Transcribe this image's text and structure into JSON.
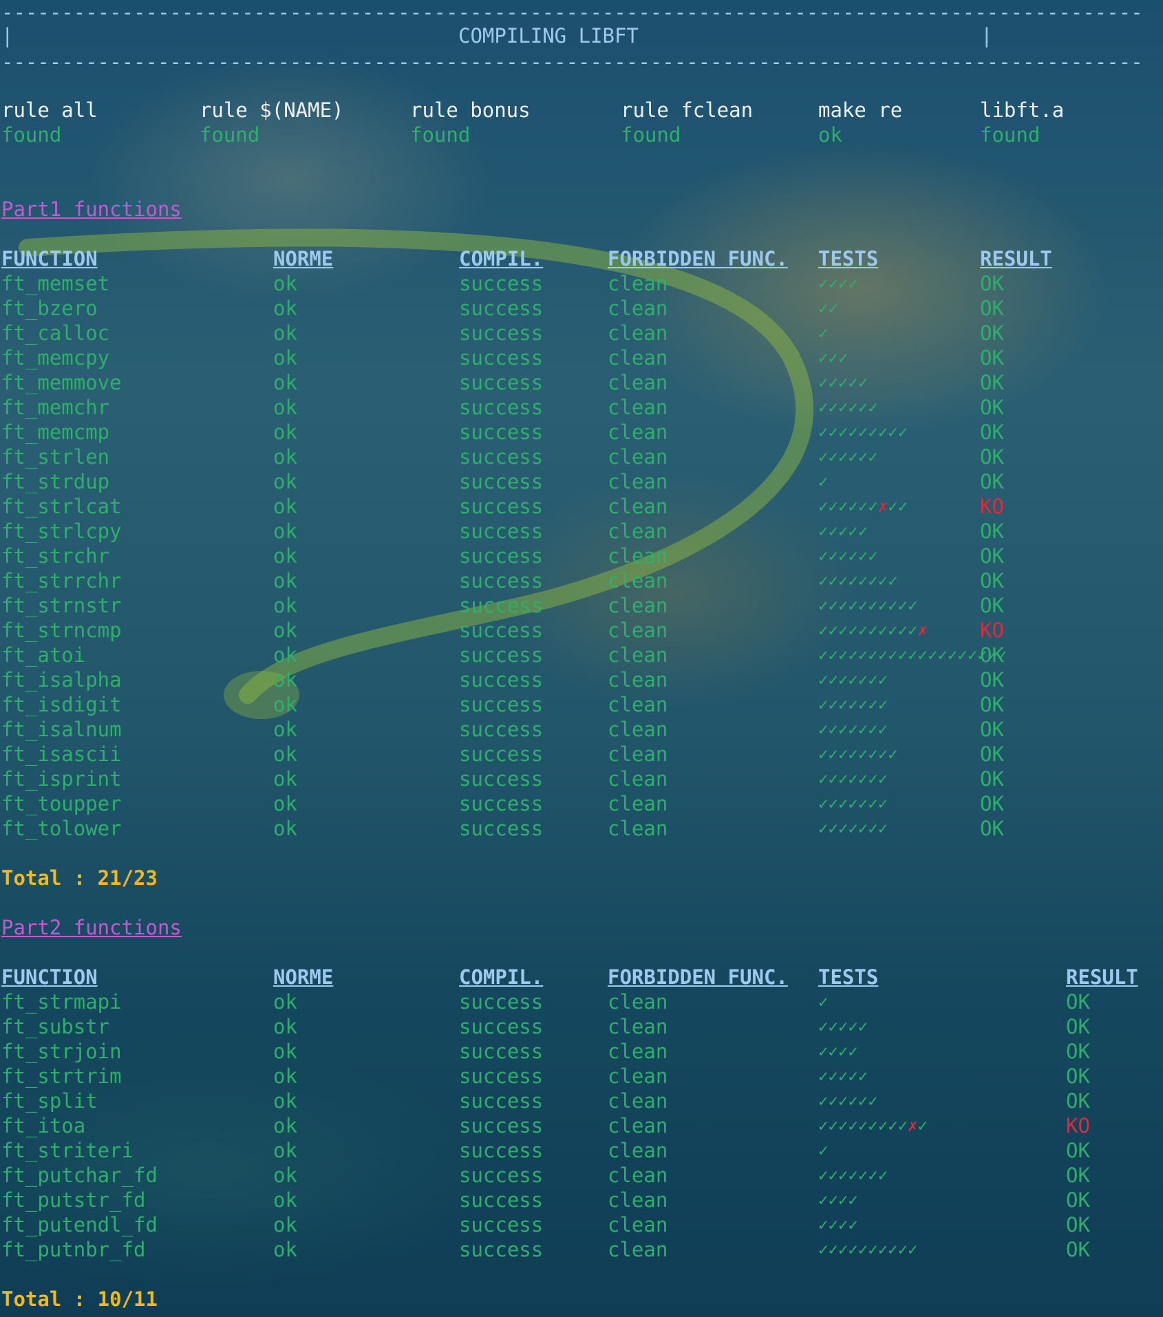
{
  "banner": {
    "dashes": "-----------------------------------------------------------------------------------------------",
    "left_bar": "|",
    "title": "COMPILING LIBFT",
    "right_bar": "|"
  },
  "rules": [
    {
      "label": "rule all",
      "status": "found"
    },
    {
      "label": "rule $(NAME)",
      "status": "found"
    },
    {
      "label": "rule bonus",
      "status": "found"
    },
    {
      "label": "rule fclean",
      "status": "found"
    },
    {
      "label": "make re",
      "status": "ok"
    },
    {
      "label": "libft.a",
      "status": "found"
    }
  ],
  "headers": {
    "function": "FUNCTION",
    "norme": "NORME",
    "compil": "COMPIL.",
    "forbidden": "FORBIDDEN FUNC.",
    "tests": "TESTS",
    "result": "RESULT"
  },
  "part1": {
    "title": "Part1 functions",
    "total": "Total : 21/23",
    "rows": [
      {
        "fn": "ft_memset",
        "norme": "ok",
        "compil": "success",
        "forbidden": "clean",
        "tests": "✓✓✓✓",
        "result": "OK"
      },
      {
        "fn": "ft_bzero",
        "norme": "ok",
        "compil": "success",
        "forbidden": "clean",
        "tests": "✓✓",
        "result": "OK"
      },
      {
        "fn": "ft_calloc",
        "norme": "ok",
        "compil": "success",
        "forbidden": "clean",
        "tests": "✓",
        "result": "OK"
      },
      {
        "fn": "ft_memcpy",
        "norme": "ok",
        "compil": "success",
        "forbidden": "clean",
        "tests": "✓✓✓",
        "result": "OK"
      },
      {
        "fn": "ft_memmove",
        "norme": "ok",
        "compil": "success",
        "forbidden": "clean",
        "tests": "✓✓✓✓✓",
        "result": "OK"
      },
      {
        "fn": "ft_memchr",
        "norme": "ok",
        "compil": "success",
        "forbidden": "clean",
        "tests": "✓✓✓✓✓✓",
        "result": "OK"
      },
      {
        "fn": "ft_memcmp",
        "norme": "ok",
        "compil": "success",
        "forbidden": "clean",
        "tests": "✓✓✓✓✓✓✓✓✓",
        "result": "OK"
      },
      {
        "fn": "ft_strlen",
        "norme": "ok",
        "compil": "success",
        "forbidden": "clean",
        "tests": "✓✓✓✓✓✓",
        "result": "OK"
      },
      {
        "fn": "ft_strdup",
        "norme": "ok",
        "compil": "success",
        "forbidden": "clean",
        "tests": "✓",
        "result": "OK"
      },
      {
        "fn": "ft_strlcat",
        "norme": "ok",
        "compil": "success",
        "forbidden": "clean",
        "tests": "✓✓✓✓✓✓",
        "tests_fail": "✗",
        "tests_after": "✓✓",
        "result": "KO"
      },
      {
        "fn": "ft_strlcpy",
        "norme": "ok",
        "compil": "success",
        "forbidden": "clean",
        "tests": "✓✓✓✓✓",
        "result": "OK"
      },
      {
        "fn": "ft_strchr",
        "norme": "ok",
        "compil": "success",
        "forbidden": "clean",
        "tests": "✓✓✓✓✓✓",
        "result": "OK"
      },
      {
        "fn": "ft_strrchr",
        "norme": "ok",
        "compil": "success",
        "forbidden": "clean",
        "tests": "✓✓✓✓✓✓✓✓",
        "result": "OK"
      },
      {
        "fn": "ft_strnstr",
        "norme": "ok",
        "compil": "success",
        "forbidden": "clean",
        "tests": "✓✓✓✓✓✓✓✓✓✓",
        "result": "OK"
      },
      {
        "fn": "ft_strncmp",
        "norme": "ok",
        "compil": "success",
        "forbidden": "clean",
        "tests": "✓✓✓✓✓✓✓✓✓✓",
        "tests_fail": "✗",
        "tests_after": "",
        "result": "KO"
      },
      {
        "fn": "ft_atoi",
        "norme": "ok",
        "compil": "success",
        "forbidden": "clean",
        "tests": "✓✓✓✓✓✓✓✓✓✓✓✓✓✓✓✓✓✓✓",
        "result": "OK"
      },
      {
        "fn": "ft_isalpha",
        "norme": "ok",
        "compil": "success",
        "forbidden": "clean",
        "tests": "✓✓✓✓✓✓✓",
        "result": "OK"
      },
      {
        "fn": "ft_isdigit",
        "norme": "ok",
        "compil": "success",
        "forbidden": "clean",
        "tests": "✓✓✓✓✓✓✓",
        "result": "OK"
      },
      {
        "fn": "ft_isalnum",
        "norme": "ok",
        "compil": "success",
        "forbidden": "clean",
        "tests": "✓✓✓✓✓✓✓",
        "result": "OK"
      },
      {
        "fn": "ft_isascii",
        "norme": "ok",
        "compil": "success",
        "forbidden": "clean",
        "tests": "✓✓✓✓✓✓✓✓",
        "result": "OK"
      },
      {
        "fn": "ft_isprint",
        "norme": "ok",
        "compil": "success",
        "forbidden": "clean",
        "tests": "✓✓✓✓✓✓✓",
        "result": "OK"
      },
      {
        "fn": "ft_toupper",
        "norme": "ok",
        "compil": "success",
        "forbidden": "clean",
        "tests": "✓✓✓✓✓✓✓",
        "result": "OK"
      },
      {
        "fn": "ft_tolower",
        "norme": "ok",
        "compil": "success",
        "forbidden": "clean",
        "tests": "✓✓✓✓✓✓✓",
        "result": "OK"
      }
    ]
  },
  "part2": {
    "title": "Part2 functions",
    "total": "Total : 10/11",
    "rows": [
      {
        "fn": "ft_strmapi",
        "norme": "ok",
        "compil": "success",
        "forbidden": "clean",
        "tests": "✓",
        "result": "OK"
      },
      {
        "fn": "ft_substr",
        "norme": "ok",
        "compil": "success",
        "forbidden": "clean",
        "tests": "✓✓✓✓✓",
        "result": "OK"
      },
      {
        "fn": "ft_strjoin",
        "norme": "ok",
        "compil": "success",
        "forbidden": "clean",
        "tests": "✓✓✓✓",
        "result": "OK"
      },
      {
        "fn": "ft_strtrim",
        "norme": "ok",
        "compil": "success",
        "forbidden": "clean",
        "tests": "✓✓✓✓✓",
        "result": "OK"
      },
      {
        "fn": "ft_split",
        "norme": "ok",
        "compil": "success",
        "forbidden": "clean",
        "tests": "✓✓✓✓✓✓",
        "result": "OK"
      },
      {
        "fn": "ft_itoa",
        "norme": "ok",
        "compil": "success",
        "forbidden": "clean",
        "tests": "✓✓✓✓✓✓✓✓✓",
        "tests_fail": "✗",
        "tests_after": "✓",
        "result": "KO"
      },
      {
        "fn": "ft_striteri",
        "norme": "ok",
        "compil": "success",
        "forbidden": "clean",
        "tests": "✓",
        "result": "OK"
      },
      {
        "fn": "ft_putchar_fd",
        "norme": "ok",
        "compil": "success",
        "forbidden": "clean",
        "tests": "✓✓✓✓✓✓✓",
        "result": "OK"
      },
      {
        "fn": "ft_putstr_fd",
        "norme": "ok",
        "compil": "success",
        "forbidden": "clean",
        "tests": "✓✓✓✓",
        "result": "OK"
      },
      {
        "fn": "ft_putendl_fd",
        "norme": "ok",
        "compil": "success",
        "forbidden": "clean",
        "tests": "✓✓✓✓",
        "result": "OK"
      },
      {
        "fn": "ft_putnbr_fd",
        "norme": "ok",
        "compil": "success",
        "forbidden": "clean",
        "tests": "✓✓✓✓✓✓✓✓✓✓",
        "result": "OK"
      }
    ]
  },
  "colors": {
    "ok_green": "#2fae6c",
    "ko_red": "#e3283a",
    "header_blue": "#9ec9ef",
    "section_purple": "#c05bd0",
    "total_yellow": "#f0b91f"
  }
}
